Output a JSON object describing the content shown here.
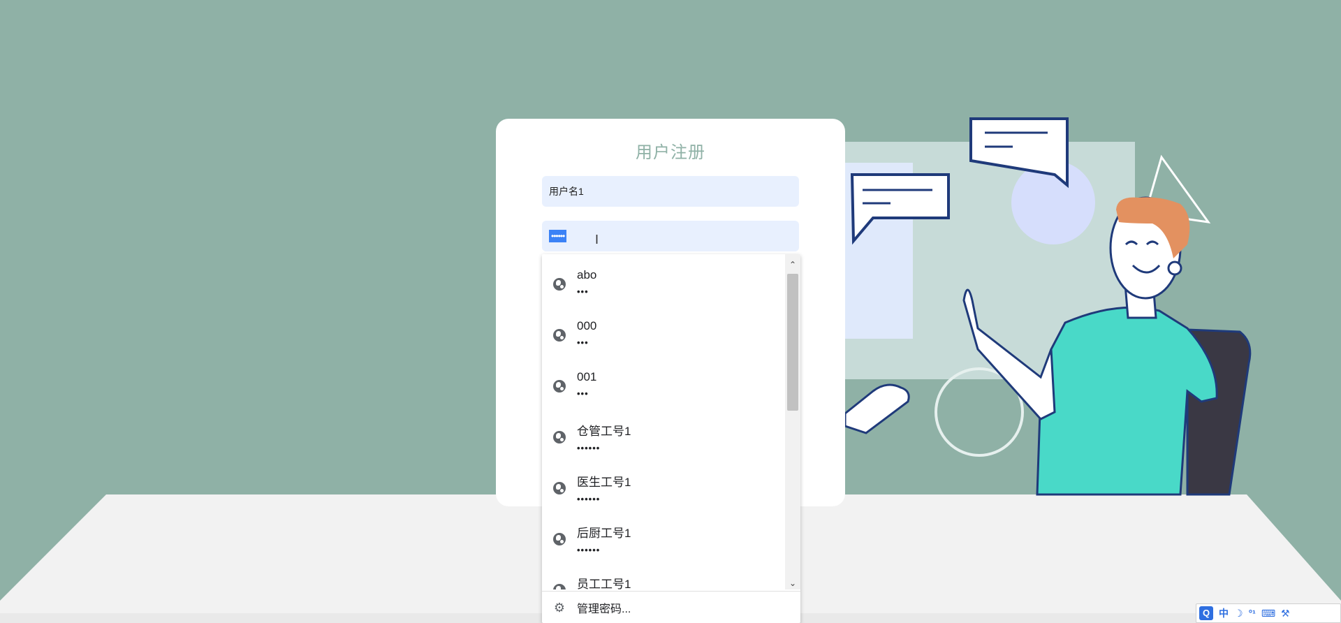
{
  "form": {
    "title": "用户注册",
    "username_value": "用户名1",
    "password_value": "••••••"
  },
  "autofill": {
    "items": [
      {
        "username": "abo",
        "password": "•••"
      },
      {
        "username": "000",
        "password": "•••"
      },
      {
        "username": "001",
        "password": "•••"
      },
      {
        "username": "仓管工号1",
        "password": "••••••"
      },
      {
        "username": "医生工号1",
        "password": "••••••"
      },
      {
        "username": "后厨工号1",
        "password": "••••••"
      },
      {
        "username": "员工工号1",
        "password": "••••••"
      }
    ],
    "manage_label": "管理密码..."
  },
  "tray": {
    "ime_label": "中",
    "moon_glyph": "☽",
    "dots_glyph": "°¹",
    "keyboard_glyph": "⌨",
    "tool_glyph": "⚒"
  },
  "colors": {
    "background": "#8fb1a6",
    "card": "#ffffff",
    "title": "#8fb1a6",
    "input_fill": "#e8f0fe",
    "selection": "#3b82f6",
    "shirt": "#49d9c8",
    "hair": "#e39160",
    "outline": "#1f3a7a"
  }
}
